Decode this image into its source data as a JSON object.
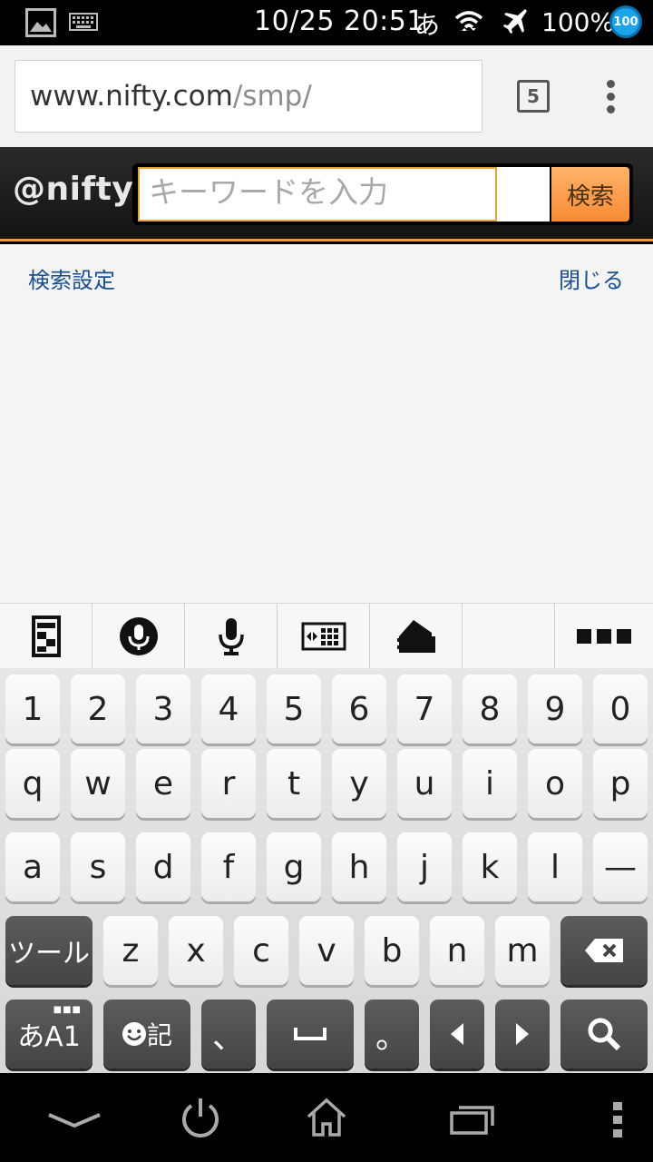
{
  "status_bar": {
    "time": "10/25 20:51",
    "ime_indicator": "あ",
    "battery": "100%",
    "badge": "100",
    "icons": [
      "image-icon",
      "keyboard-icon",
      "wifi-icon",
      "airplane-icon"
    ]
  },
  "browser": {
    "url_host": "www.nifty.com",
    "url_path": "/smp/",
    "tab_count": "5"
  },
  "nifty": {
    "logo": "@nifty",
    "search_placeholder": "キーワードを入力",
    "search_button": "検索"
  },
  "content": {
    "search_settings": "検索設定",
    "close": "閉じる"
  },
  "keyboard": {
    "toolbar_icons": [
      "window-icon",
      "voice-input-icon",
      "microphone-icon",
      "keyboard-switch-icon",
      "folder-icon",
      "blank",
      "more-icon"
    ],
    "row1": [
      "1",
      "2",
      "3",
      "4",
      "5",
      "6",
      "7",
      "8",
      "9",
      "0"
    ],
    "row2": [
      "q",
      "w",
      "e",
      "r",
      "t",
      "y",
      "u",
      "i",
      "o",
      "p"
    ],
    "row3": [
      "a",
      "s",
      "d",
      "f",
      "g",
      "h",
      "j",
      "k",
      "l",
      "—"
    ],
    "row4": [
      "z",
      "x",
      "c",
      "v",
      "b",
      "n",
      "m"
    ],
    "tool_key": "ツール",
    "mode_key": "あA1",
    "emoji_key": "記",
    "comma_key": "、",
    "period_key": "。"
  },
  "nav_bar": {
    "icons": [
      "hide-keyboard-icon",
      "power-icon",
      "home-icon",
      "recent-apps-icon",
      "overflow-menu-icon"
    ]
  },
  "colors": {
    "accent_orange": "#f88b34",
    "link_blue": "#1a4e91",
    "badge_blue": "#1fa3e8"
  }
}
